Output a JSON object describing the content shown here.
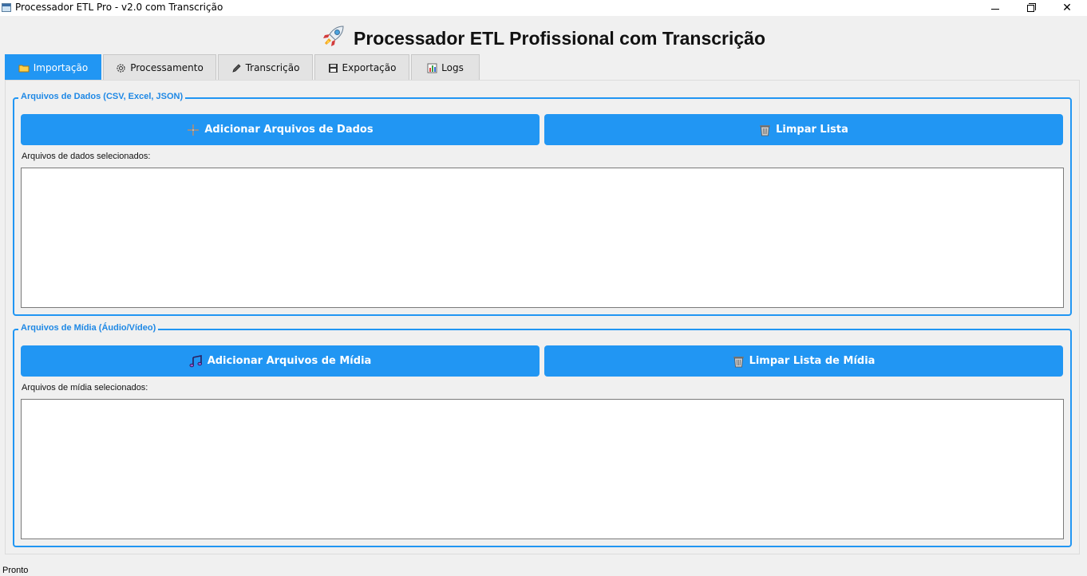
{
  "window": {
    "title": "Processador ETL Pro - v2.0 com Transcrição",
    "controls": {
      "minimize": "minimize-icon",
      "maximize": "maximize-icon",
      "close": "close-icon"
    }
  },
  "header": {
    "icon": "rocket-icon",
    "title": "Processador ETL Profissional com Transcrição"
  },
  "tabs": [
    {
      "label": "Importação",
      "icon": "folder-icon",
      "active": true
    },
    {
      "label": "Processamento",
      "icon": "gear-icon",
      "active": false
    },
    {
      "label": "Transcrição",
      "icon": "pen-icon",
      "active": false
    },
    {
      "label": "Exportação",
      "icon": "floppy-disk-icon",
      "active": false
    },
    {
      "label": "Logs",
      "icon": "bar-chart-icon",
      "active": false
    }
  ],
  "data_files": {
    "group_title": "Arquivos de Dados (CSV, Excel, JSON)",
    "add_button": "Adicionar Arquivos de Dados",
    "clear_button": "Limpar Lista",
    "list_label": "Arquivos de dados selecionados:",
    "items": []
  },
  "media_files": {
    "group_title": "Arquivos de Mídia (Áudio/Vídeo)",
    "add_button": "Adicionar Arquivos de Mídia",
    "clear_button": "Limpar Lista de Mídia",
    "list_label": "Arquivos de mídia selecionados:",
    "items": []
  },
  "status_bar": {
    "text": "Pronto"
  },
  "colors": {
    "accent": "#2196f3",
    "group_title": "#1e88e5",
    "background": "#f0f0f0"
  }
}
